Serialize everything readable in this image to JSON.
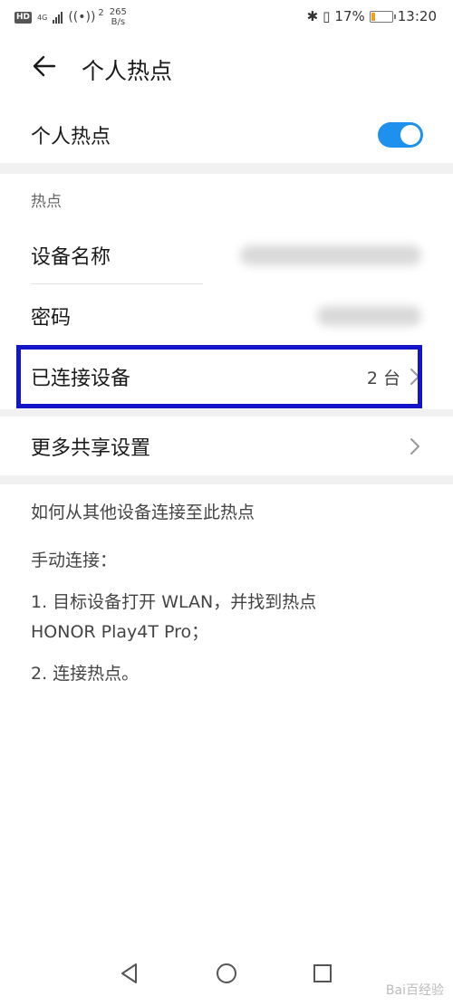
{
  "status_bar": {
    "hd_badge": "HD",
    "network_type": "4G",
    "hotspot_connected_count": "2",
    "speed_value": "265",
    "speed_unit": "B/s",
    "battery_percent": "17%",
    "battery_level": 0.17,
    "time": "13:20"
  },
  "header": {
    "title": "个人热点"
  },
  "hotspot_toggle": {
    "label": "个人热点",
    "enabled": true
  },
  "hotspot_section": {
    "heading": "热点",
    "device_name_label": "设备名称",
    "password_label": "密码",
    "connected_devices_label": "已连接设备",
    "connected_devices_value": "2 台"
  },
  "more_sharing": {
    "label": "更多共享设置"
  },
  "help": {
    "title": "如何从其他设备连接至此热点",
    "manual_heading": "手动连接：",
    "step1_line1": "1. 目标设备打开 WLAN，并找到热点",
    "step1_line2": "HONOR Play4T Pro；",
    "step2": "2. 连接热点。"
  },
  "watermark": "Bai百经验",
  "colors": {
    "accent": "#1e90ee",
    "highlight": "#1414c8"
  }
}
